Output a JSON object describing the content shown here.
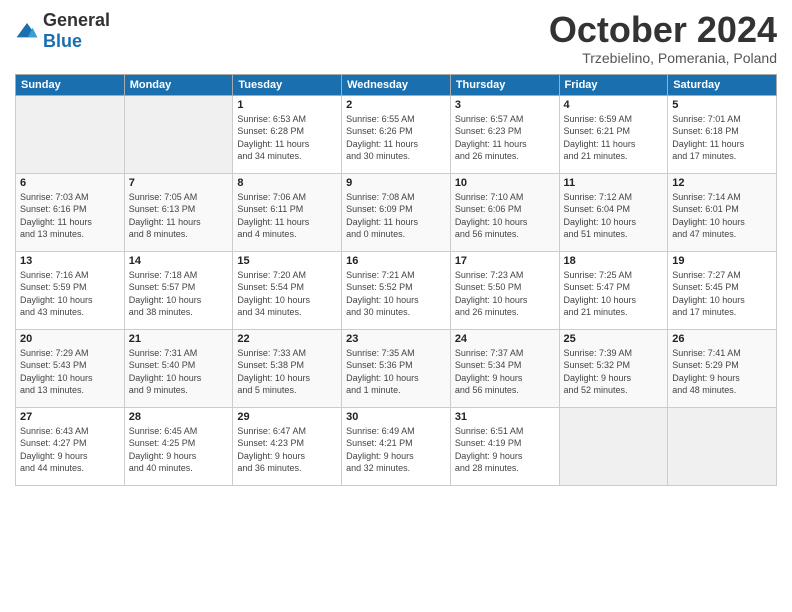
{
  "header": {
    "logo_general": "General",
    "logo_blue": "Blue",
    "month": "October 2024",
    "location": "Trzebielino, Pomerania, Poland"
  },
  "weekdays": [
    "Sunday",
    "Monday",
    "Tuesday",
    "Wednesday",
    "Thursday",
    "Friday",
    "Saturday"
  ],
  "weeks": [
    [
      {
        "day": "",
        "info": ""
      },
      {
        "day": "",
        "info": ""
      },
      {
        "day": "1",
        "info": "Sunrise: 6:53 AM\nSunset: 6:28 PM\nDaylight: 11 hours\nand 34 minutes."
      },
      {
        "day": "2",
        "info": "Sunrise: 6:55 AM\nSunset: 6:26 PM\nDaylight: 11 hours\nand 30 minutes."
      },
      {
        "day": "3",
        "info": "Sunrise: 6:57 AM\nSunset: 6:23 PM\nDaylight: 11 hours\nand 26 minutes."
      },
      {
        "day": "4",
        "info": "Sunrise: 6:59 AM\nSunset: 6:21 PM\nDaylight: 11 hours\nand 21 minutes."
      },
      {
        "day": "5",
        "info": "Sunrise: 7:01 AM\nSunset: 6:18 PM\nDaylight: 11 hours\nand 17 minutes."
      }
    ],
    [
      {
        "day": "6",
        "info": "Sunrise: 7:03 AM\nSunset: 6:16 PM\nDaylight: 11 hours\nand 13 minutes."
      },
      {
        "day": "7",
        "info": "Sunrise: 7:05 AM\nSunset: 6:13 PM\nDaylight: 11 hours\nand 8 minutes."
      },
      {
        "day": "8",
        "info": "Sunrise: 7:06 AM\nSunset: 6:11 PM\nDaylight: 11 hours\nand 4 minutes."
      },
      {
        "day": "9",
        "info": "Sunrise: 7:08 AM\nSunset: 6:09 PM\nDaylight: 11 hours\nand 0 minutes."
      },
      {
        "day": "10",
        "info": "Sunrise: 7:10 AM\nSunset: 6:06 PM\nDaylight: 10 hours\nand 56 minutes."
      },
      {
        "day": "11",
        "info": "Sunrise: 7:12 AM\nSunset: 6:04 PM\nDaylight: 10 hours\nand 51 minutes."
      },
      {
        "day": "12",
        "info": "Sunrise: 7:14 AM\nSunset: 6:01 PM\nDaylight: 10 hours\nand 47 minutes."
      }
    ],
    [
      {
        "day": "13",
        "info": "Sunrise: 7:16 AM\nSunset: 5:59 PM\nDaylight: 10 hours\nand 43 minutes."
      },
      {
        "day": "14",
        "info": "Sunrise: 7:18 AM\nSunset: 5:57 PM\nDaylight: 10 hours\nand 38 minutes."
      },
      {
        "day": "15",
        "info": "Sunrise: 7:20 AM\nSunset: 5:54 PM\nDaylight: 10 hours\nand 34 minutes."
      },
      {
        "day": "16",
        "info": "Sunrise: 7:21 AM\nSunset: 5:52 PM\nDaylight: 10 hours\nand 30 minutes."
      },
      {
        "day": "17",
        "info": "Sunrise: 7:23 AM\nSunset: 5:50 PM\nDaylight: 10 hours\nand 26 minutes."
      },
      {
        "day": "18",
        "info": "Sunrise: 7:25 AM\nSunset: 5:47 PM\nDaylight: 10 hours\nand 21 minutes."
      },
      {
        "day": "19",
        "info": "Sunrise: 7:27 AM\nSunset: 5:45 PM\nDaylight: 10 hours\nand 17 minutes."
      }
    ],
    [
      {
        "day": "20",
        "info": "Sunrise: 7:29 AM\nSunset: 5:43 PM\nDaylight: 10 hours\nand 13 minutes."
      },
      {
        "day": "21",
        "info": "Sunrise: 7:31 AM\nSunset: 5:40 PM\nDaylight: 10 hours\nand 9 minutes."
      },
      {
        "day": "22",
        "info": "Sunrise: 7:33 AM\nSunset: 5:38 PM\nDaylight: 10 hours\nand 5 minutes."
      },
      {
        "day": "23",
        "info": "Sunrise: 7:35 AM\nSunset: 5:36 PM\nDaylight: 10 hours\nand 1 minute."
      },
      {
        "day": "24",
        "info": "Sunrise: 7:37 AM\nSunset: 5:34 PM\nDaylight: 9 hours\nand 56 minutes."
      },
      {
        "day": "25",
        "info": "Sunrise: 7:39 AM\nSunset: 5:32 PM\nDaylight: 9 hours\nand 52 minutes."
      },
      {
        "day": "26",
        "info": "Sunrise: 7:41 AM\nSunset: 5:29 PM\nDaylight: 9 hours\nand 48 minutes."
      }
    ],
    [
      {
        "day": "27",
        "info": "Sunrise: 6:43 AM\nSunset: 4:27 PM\nDaylight: 9 hours\nand 44 minutes."
      },
      {
        "day": "28",
        "info": "Sunrise: 6:45 AM\nSunset: 4:25 PM\nDaylight: 9 hours\nand 40 minutes."
      },
      {
        "day": "29",
        "info": "Sunrise: 6:47 AM\nSunset: 4:23 PM\nDaylight: 9 hours\nand 36 minutes."
      },
      {
        "day": "30",
        "info": "Sunrise: 6:49 AM\nSunset: 4:21 PM\nDaylight: 9 hours\nand 32 minutes."
      },
      {
        "day": "31",
        "info": "Sunrise: 6:51 AM\nSunset: 4:19 PM\nDaylight: 9 hours\nand 28 minutes."
      },
      {
        "day": "",
        "info": ""
      },
      {
        "day": "",
        "info": ""
      }
    ]
  ]
}
